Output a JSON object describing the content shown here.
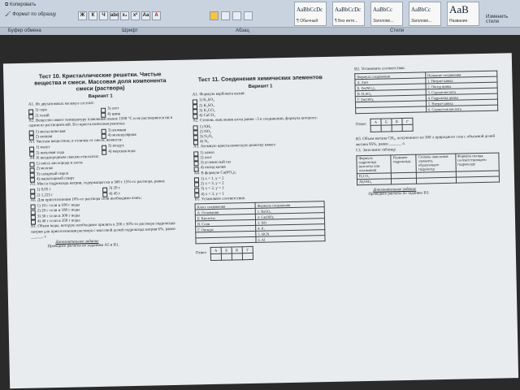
{
  "ribbon": {
    "clipboard": {
      "copy_label": "Копировать",
      "format_painter_label": "Формат по образцу"
    },
    "font_buttons": [
      "Ж",
      "К",
      "Ч",
      "abc",
      "x₂",
      "x²",
      "Aa",
      "A"
    ],
    "group_labels": [
      "Буфер обмена",
      "Шрифт",
      "Абзац",
      "Стили"
    ],
    "styles": [
      {
        "sample": "AaBbCcDc",
        "label": "¶ Обычный"
      },
      {
        "sample": "AaBbCcDc",
        "label": "¶ Без инте..."
      },
      {
        "sample": "AaBbCc",
        "label": "Заголово..."
      },
      {
        "sample": "AaBbCc",
        "label": "Заголово..."
      },
      {
        "sample": "AaB",
        "label": "Название"
      }
    ],
    "change_styles_label": "Изменить стили"
  },
  "document": {
    "test10": {
      "title": "Тест 10. Кристаллические решетки. Чистые вещества и смеси. Массовая доля компонента смеси (раствора)",
      "variant": "Вариант 1",
      "a1": "А1. Из двухатомных молекул состоит:",
      "a1_opts": [
        "1) сера",
        "2) гелий",
        "3) азот",
        "4) цинк"
      ],
      "a2": "А2. Вещество имеет температуру плавления свыше 1500 °С и не растворяется ни в одном из растворителей. Его кристаллическая решетка:",
      "a2_opts": [
        "1) металлическая",
        "2) ионная",
        "3) атомная",
        "4) молекулярная"
      ],
      "a3": "А3. Чистым веществом, в отличие от смеси, является:",
      "a3_opts": [
        "1) мазут",
        "2) питьевая сода",
        "3) воздух",
        "4) морская вода"
      ],
      "a4": "А4. К неоднородным смесям относится:",
      "a4_opts": [
        "1) смесь кислорода и азота",
        "2) молоко",
        "3) сахарный сироп",
        "4) нашатырный спирт"
      ],
      "a5": "А5. Масса гидроксида натрия, содержащегося в 300 г 15%-го раствора, равна:",
      "a5_opts": [
        "1) 0,05 г",
        "2) 1,225 г",
        "3) 20 г",
        "4) 45 г"
      ],
      "a6": "А6. Для приготовления 10%-го раствора соли необходимо взять:",
      "a6_opts": [
        "1) 10 г соли и 100 г воды",
        "2) 20 г соли и 180 г воды",
        "3) 30 г соли и 300 г воды",
        "4) 40 г соли и 350 г воды"
      ],
      "b1": "В1. Объем воды, которую необходимо прилить к 200 г 30%-го раствора гидроксида натрия для приготовления раствора с массовой долей гидроксида натрия 6%, равен ______ г.",
      "extra_title": "Дополнительное задание",
      "extra": "Проведите расчеты по заданиям А5 и В1."
    },
    "test11": {
      "title": "Тест 11. Соединения химических элементов",
      "variant": "Вариант 1",
      "a1": "А1. Формула карбоната калия:",
      "a1_opts": [
        "1) K₂SO₄",
        "2) K₂SO₃",
        "3) K₂CO₃",
        "4) CaCO₃"
      ],
      "a2": "А2. Степень окисления азота равна –3 в соединении, формула которого:",
      "a2_opts": [
        "1) NH₃",
        "2) NO₂",
        "3) N₂O₅",
        "4) N₂"
      ],
      "a3": "А3. Атомную кристаллическую решетку имеет:",
      "a3_opts": [
        "1) алмаз",
        "2) азот",
        "3) углекислый газ",
        "4) оксид калия"
      ],
      "a4": "А4. В формуле Ca(PO₄)ᵧ:",
      "a4_opts": [
        "1) x = 1, y = 2",
        "2) x = 3, y = 2",
        "3) x = 2, y = 1",
        "4) x = 3, y = 1"
      ],
      "b1": "В1. Установите соответствие.",
      "b1_headers": [
        "Класс соединения",
        "Формула соединения"
      ],
      "b1_left": [
        "А. Основания",
        "Б. Кислоты",
        "В. Соли",
        "Г. Оксиды"
      ],
      "b1_right": [
        "1. BaSO₄",
        "2. Ca(OH)₂",
        "3. NO",
        "4. P₂",
        "5. HCN",
        "6. Al"
      ],
      "answer_label": "Ответ:",
      "answer_cols": [
        "А",
        "Б",
        "В",
        "Г"
      ]
    },
    "right": {
      "b2": "В2. Установите соответствие.",
      "b2_headers": [
        "Формула соединения",
        "Название соединения"
      ],
      "b2_left": [
        "А. ZnO",
        "Б. Zn(NO₃)₂",
        "В. H₂SO₄",
        "Г. Zn(OH)₂"
      ],
      "b2_right": [
        "1. Нитрит цинка",
        "2. Оксид цинка",
        "3. Серная кислота",
        "4. Гидроксид цинка",
        "5. Нитрат цинка",
        "6. Сернистая кислота"
      ],
      "answer_label": "Ответ:",
      "answer_cols": [
        "А",
        "Б",
        "В",
        "Г"
      ],
      "b3": "В3. Объем метана CH₄, полученного из 300 л природного газа с объемной долей метана 95%, равен ______ л.",
      "c1": "С1. Заполните таблицу.",
      "c1_headers": [
        "Формула гидроксида (кислоты или основания)",
        "Название гидроксида",
        "Степень окисления элемента, образующего гидроксид",
        "Формула оксида, соответствующего гидроксиду"
      ],
      "c1_rows": [
        "H₂CO₃",
        "Al(OH)₃"
      ],
      "extra_title": "Дополнительное задание",
      "extra": "Проведите расчеты по заданию В3."
    }
  }
}
